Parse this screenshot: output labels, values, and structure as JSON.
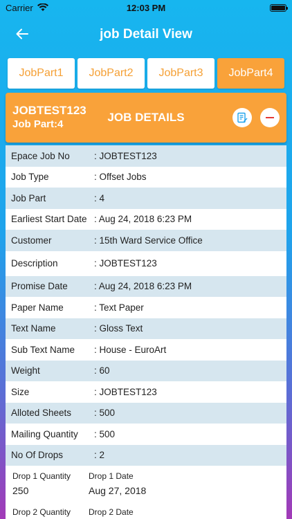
{
  "status": {
    "carrier": "Carrier",
    "time": "12:03 PM"
  },
  "nav": {
    "title": "job Detail View",
    "back_icon": "←"
  },
  "tabs": [
    {
      "label": "JobPart1",
      "active": false
    },
    {
      "label": "JobPart2",
      "active": false
    },
    {
      "label": "JobPart3",
      "active": false
    },
    {
      "label": "JobPart4",
      "active": true
    }
  ],
  "header": {
    "job": "JOBTEST123",
    "part": "Job Part:4",
    "title": "JOB DETAILS"
  },
  "details": [
    {
      "label": "Epace Job No",
      "value": ": JOBTEST123"
    },
    {
      "label": "Job Type",
      "value": ": Offset Jobs"
    },
    {
      "label": "Job Part",
      "value": ": 4"
    },
    {
      "label": "Earliest Start Date",
      "value": ": Aug 24, 2018 6:23 PM"
    },
    {
      "label": "Customer",
      "value": ": 15th Ward Service Office"
    },
    {
      "label": "Description",
      "value": ": JOBTEST123"
    },
    {
      "label": "Promise Date",
      "value": ": Aug 24, 2018 6:23 PM"
    },
    {
      "label": "Paper Name",
      "value": ": Text Paper"
    },
    {
      "label": "Text Name",
      "value": ": Gloss Text"
    },
    {
      "label": "Sub Text Name",
      "value": ": House - EuroArt"
    },
    {
      "label": "Weight",
      "value": ": 60"
    },
    {
      "label": "Size",
      "value": ": JOBTEST123"
    },
    {
      "label": "Alloted Sheets",
      "value": ": 500"
    },
    {
      "label": "Mailing Quantity",
      "value": ": 500"
    },
    {
      "label": "No Of Drops",
      "value": ": 2"
    }
  ],
  "drops": {
    "drop1_qty_label": "Drop 1 Quantity",
    "drop1_qty": "250",
    "drop1_date_label": "Drop 1 Date",
    "drop1_date": "Aug 27, 2018",
    "drop2_qty_label": "Drop 2 Quantity",
    "drop2_date_label": "Drop 2 Date"
  },
  "colors": {
    "accent": "#f9a23a",
    "row_alt": "#d6e6ef",
    "danger": "#e53935"
  }
}
